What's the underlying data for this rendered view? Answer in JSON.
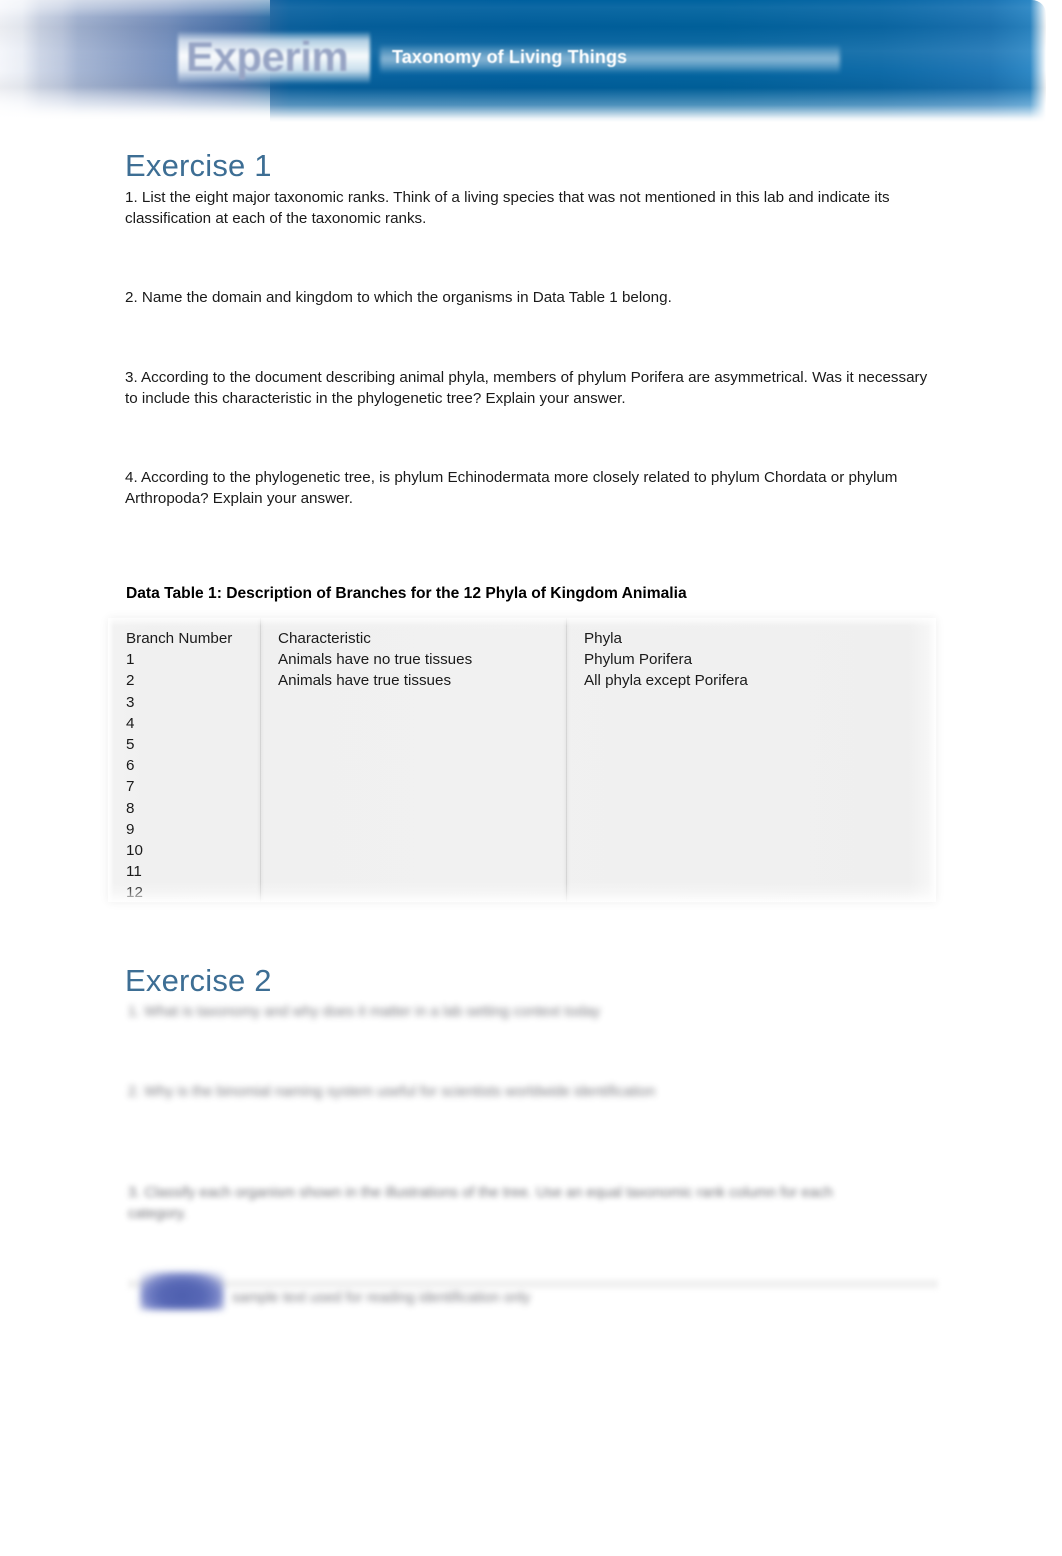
{
  "header": {
    "badge_label": "Experim",
    "title": "Taxonomy of Living Things"
  },
  "exercise1": {
    "heading": "Exercise 1",
    "questions": [
      "1. List the eight major taxonomic ranks. Think of a living species that was not mentioned in this lab and indicate its classification at each of the taxonomic ranks.",
      "2. Name the domain and kingdom to which the organisms in Data Table 1 belong.",
      "3. According to the document describing animal phyla, members of phylum Porifera are asymmetrical. Was it necessary to include this characteristic in the phylogenetic tree? Explain your answer.",
      "4. According to the phylogenetic tree, is phylum Echinodermata more closely related to phylum Chordata or phylum Arthropoda? Explain your answer."
    ]
  },
  "data_table": {
    "caption": "Data Table 1: Description of Branches for the 12 Phyla of Kingdom Animalia",
    "columns": [
      "Branch Number",
      "Characteristic",
      "Phyla"
    ],
    "rows": [
      [
        "1",
        "Animals have no true tissues",
        "Phylum Porifera"
      ],
      [
        "2",
        "Animals have true tissues",
        "All phyla except Porifera"
      ],
      [
        "3",
        "",
        ""
      ],
      [
        "4",
        "",
        ""
      ],
      [
        "5",
        "",
        ""
      ],
      [
        "6",
        "",
        ""
      ],
      [
        "7",
        "",
        ""
      ],
      [
        "8",
        "",
        ""
      ],
      [
        "9",
        "",
        ""
      ],
      [
        "10",
        "",
        ""
      ],
      [
        "11",
        "",
        ""
      ],
      [
        "12",
        "",
        ""
      ]
    ]
  },
  "exercise2": {
    "heading": "Exercise 2",
    "obscured_lines": [
      "1. What is taxonomy and why does it matter in a lab setting context today",
      "2. Why is the binomial naming system useful for scientists worldwide identification"
    ],
    "obscured_paragraph": "3. Classify each organism shown in the illustrations of the tree. Use an equal taxonomic rank column for each category.",
    "footer_text": "sample text used for reading identification only"
  },
  "colors": {
    "heading_blue": "#3d6e94",
    "banner_blue": "#00609f",
    "table_background": "#f0f0f0",
    "body_text": "#1a1a1a"
  }
}
